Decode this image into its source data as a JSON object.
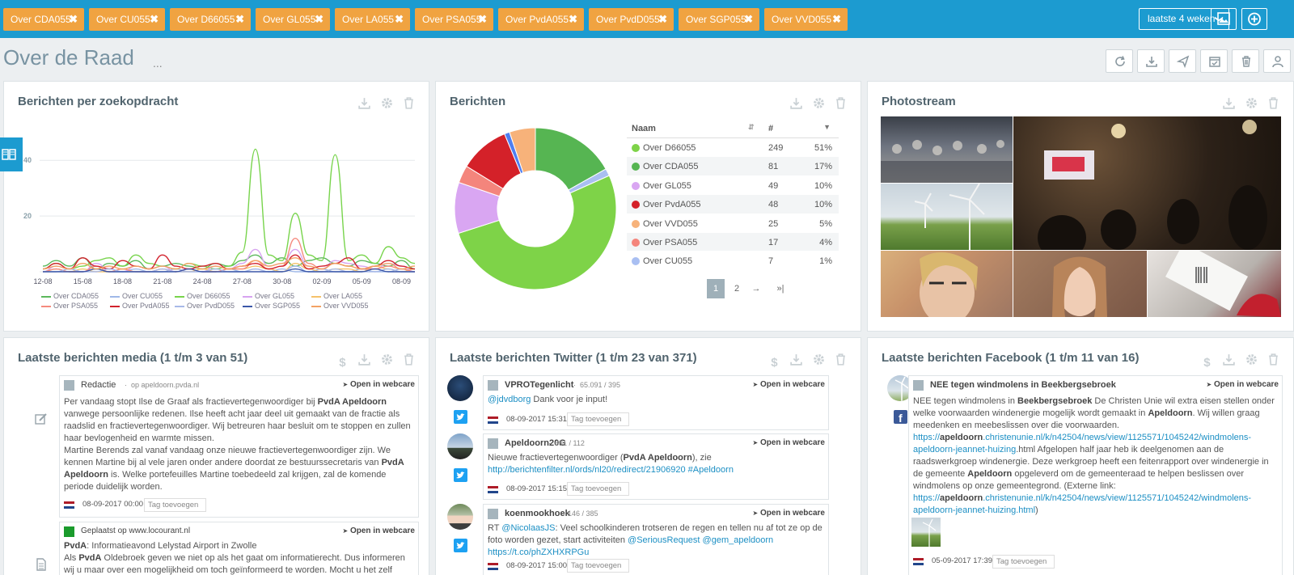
{
  "filters": [
    "Over CDA055",
    "Over CU055",
    "Over D66055",
    "Over GL055",
    "Over LA055",
    "Over PSA055",
    "Over PvdA055",
    "Over PvdD055",
    "Over SGP055",
    "Over VVD055"
  ],
  "filter_close_glyph": "✖",
  "period": {
    "label": "laatste 4 weken",
    "caret": "❯"
  },
  "page": {
    "title": "Over de Raad",
    "more": "..."
  },
  "colors": {
    "topbar": "#1c9bd0",
    "tag": "#f0a341",
    "link": "#1c8fc4"
  },
  "panels": {
    "line_title": "Berichten per zoekopdracht",
    "pie_title": "Berichten",
    "photo_title": "Photostream",
    "media_title": "Laatste berichten media (1 t/m 3 van 51)",
    "twitter_title": "Laatste berichten Twitter (1 t/m 23 van 371)",
    "facebook_title": "Laatste berichten Facebook (1 t/m 11 van 16)"
  },
  "chart_data": [
    {
      "type": "line",
      "title": "Berichten per zoekopdracht",
      "x": [
        "12-08",
        "13-08",
        "14-08",
        "15-08",
        "16-08",
        "17-08",
        "18-08",
        "19-08",
        "20-08",
        "21-08",
        "22-08",
        "23-08",
        "24-08",
        "25-08",
        "26-08",
        "27-08",
        "28-08",
        "29-08",
        "30-08",
        "31-08",
        "01-09",
        "02-09",
        "03-09",
        "04-09",
        "05-09",
        "06-09",
        "07-09",
        "08-09",
        "09-09"
      ],
      "xticks": [
        "12-08",
        "15-08",
        "18-08",
        "21-08",
        "24-08",
        "27-08",
        "30-08",
        "02-09",
        "05-09",
        "08-09"
      ],
      "yticks": [
        20,
        40
      ],
      "ylim": [
        0,
        45
      ],
      "series": [
        {
          "name": "Over CDA055",
          "color": "#5cb85c",
          "values": [
            2,
            4,
            2,
            5,
            1,
            3,
            2,
            4,
            1,
            2,
            3,
            2,
            1,
            3,
            2,
            4,
            6,
            3,
            5,
            2,
            4,
            5,
            3,
            2,
            4,
            3,
            2,
            4,
            1
          ]
        },
        {
          "name": "Over CU055",
          "color": "#9fb8e8",
          "values": [
            0,
            1,
            0,
            0,
            1,
            0,
            0,
            1,
            0,
            0,
            1,
            0,
            0,
            0,
            1,
            0,
            1,
            0,
            1,
            0,
            0,
            1,
            0,
            0,
            1,
            0,
            0,
            1,
            0
          ]
        },
        {
          "name": "Over D66055",
          "color": "#78d44c",
          "values": [
            1,
            3,
            1,
            2,
            4,
            5,
            2,
            6,
            3,
            2,
            1,
            3,
            2,
            1,
            2,
            7,
            44,
            6,
            4,
            21,
            6,
            4,
            42,
            4,
            6,
            3,
            9,
            5,
            3
          ]
        },
        {
          "name": "Over GL055",
          "color": "#d7a3f0",
          "values": [
            0,
            2,
            1,
            0,
            3,
            1,
            0,
            2,
            1,
            2,
            0,
            1,
            0,
            2,
            1,
            3,
            8,
            2,
            3,
            8,
            2,
            1,
            4,
            3,
            2,
            1,
            3,
            2,
            0
          ]
        },
        {
          "name": "Over LA055",
          "color": "#f5c26b",
          "values": [
            0,
            1,
            0,
            1,
            0,
            0,
            1,
            0,
            0,
            1,
            0,
            0,
            1,
            0,
            1,
            1,
            2,
            1,
            0,
            3,
            1,
            0,
            1,
            1,
            0,
            2,
            1,
            0,
            1
          ]
        },
        {
          "name": "Over PSA055",
          "color": "#f58a7e",
          "values": [
            0,
            1,
            0,
            0,
            2,
            0,
            1,
            0,
            0,
            1,
            0,
            1,
            0,
            0,
            1,
            1,
            4,
            1,
            2,
            12,
            3,
            1,
            3,
            2,
            1,
            1,
            2,
            1,
            0
          ]
        },
        {
          "name": "Over PvdA055",
          "color": "#d2222d",
          "values": [
            1,
            3,
            1,
            5,
            2,
            1,
            4,
            2,
            1,
            6,
            2,
            1,
            2,
            3,
            1,
            2,
            3,
            1,
            2,
            6,
            1,
            2,
            3,
            5,
            1,
            2,
            4,
            2,
            1
          ]
        },
        {
          "name": "Over PvdD055",
          "color": "#a8b9e8",
          "values": [
            0,
            0,
            1,
            0,
            0,
            1,
            0,
            0,
            0,
            1,
            0,
            0,
            0,
            1,
            0,
            0,
            1,
            0,
            0,
            2,
            0,
            0,
            1,
            0,
            0,
            0,
            1,
            0,
            0
          ]
        },
        {
          "name": "Over SGP055",
          "color": "#3b57a8",
          "values": [
            0,
            0,
            0,
            0,
            1,
            0,
            0,
            0,
            0,
            0,
            0,
            1,
            0,
            0,
            0,
            0,
            0,
            0,
            0,
            1,
            0,
            0,
            0,
            0,
            0,
            1,
            0,
            0,
            0
          ]
        },
        {
          "name": "Over VVD055",
          "color": "#f3a264",
          "values": [
            1,
            2,
            1,
            3,
            1,
            2,
            1,
            2,
            1,
            2,
            1,
            3,
            1,
            2,
            1,
            2,
            4,
            2,
            3,
            5,
            2,
            1,
            3,
            2,
            1,
            2,
            3,
            1,
            2
          ]
        }
      ]
    },
    {
      "type": "pie",
      "title": "Berichten",
      "columns": [
        "Naam",
        "#",
        ""
      ],
      "slices": [
        {
          "name": "Over D66055",
          "count": 249,
          "pct": "51%",
          "color": "#7ed348"
        },
        {
          "name": "Over CDA055",
          "count": 81,
          "pct": "17%",
          "color": "#56b552"
        },
        {
          "name": "Over GL055",
          "count": 49,
          "pct": "10%",
          "color": "#d9a6f2"
        },
        {
          "name": "Over PvdA055",
          "count": 48,
          "pct": "10%",
          "color": "#d42129"
        },
        {
          "name": "Over VVD055",
          "count": 25,
          "pct": "5%",
          "color": "#f7b27a"
        },
        {
          "name": "Over PSA055",
          "count": 17,
          "pct": "4%",
          "color": "#f4857c"
        },
        {
          "name": "Over CU055",
          "count": 7,
          "pct": "1%",
          "color": "#a9bff2"
        }
      ],
      "pie_order": [
        "Over CDA055",
        "Over CU055",
        "Over D66055",
        "Over GL055",
        "Over PSA055",
        "Over PvdA055",
        "Over PvdD055",
        "Over VVD055"
      ],
      "pie_extra": [
        {
          "name": "Over PvdD055",
          "count": 5,
          "color": "#4f7ef0"
        }
      ]
    }
  ],
  "pager": [
    "1",
    "2",
    "→",
    "»|"
  ],
  "media": [
    {
      "source": "Redactie",
      "meta": "op apeldoorn.pvda.nl",
      "open": "Open in webcare",
      "html": "Per vandaag stopt Ilse de Graaf als fractievertegenwoordiger bij <b>PvdA Apeldoorn</b> vanwege persoonlijke redenen. Ilse heeft acht jaar deel uit gemaakt van de fractie als raadslid en fractievertegenwoordiger. Wij betreuren haar besluit om te stoppen en zullen haar bevlogenheid en warmte missen.<br>Martine Berends zal vanaf vandaag onze nieuwe fractievertegenwoordiger zijn. We kennen Martine bij al vele jaren onder andere doordat ze bestuurssecretaris van <b>PvdA Apeldoorn</b> is. Welke portefeuilles Martine toebedeeld zal krijgen, zal de komende periode duidelijk worden.",
      "date": "08-09-2017 00:00",
      "tag_placeholder": "Tag toevoegen"
    },
    {
      "source": "Geplaatst op www.locourant.nl",
      "meta": "",
      "open": "Open in webcare",
      "html": "<b>PvdA</b>: Informatieavond Lelystad Airport in Zwolle<br>Als <b>PvdA</b> Oldebroek geven we niet op als het gaat om informatierecht. Dus informeren wij u maar over een mogelijkheid om toch geïnformeerd te worden. Mocht u het zelf",
      "date": "",
      "tag_placeholder": ""
    }
  ],
  "twitter": [
    {
      "user": "VPROTegenlicht",
      "meta": "65.091 / 395",
      "open": "Open in webcare",
      "html": "<span class='link'>@jdvdborg</span> Dank voor je input!",
      "date": "08-09-2017 15:31",
      "tag_placeholder": "Tag toevoegen"
    },
    {
      "user": "Apeldoorn20G",
      "meta": "631 / 112",
      "open": "Open in webcare",
      "html": "Nieuwe fractievertegenwoordiger (<b>PvdA Apeldoorn</b>), zie <span class='link'>http://berichtenfilter.nl/ords/nl20/redirect/21906920</span> <span class='link'>#Apeldoorn</span>",
      "date": "08-09-2017 15:15",
      "tag_placeholder": "Tag toevoegen"
    },
    {
      "user": "koenmookhoek",
      "meta": "146 / 385",
      "open": "Open in webcare",
      "html": "RT <span class='link'>@NicolaasJS</span>: Veel schoolkinderen trotseren de regen en tellen nu af tot ze op de foto worden gezet, start activiteiten <span class='link'>@SeriousRequest</span> <span class='link'>@gem_apeldoorn</span> <span class='link'>https://t.co/phZXHXRPGu</span>",
      "date": "08-09-2017 15:00",
      "tag_placeholder": "Tag toevoegen"
    }
  ],
  "facebook": [
    {
      "page": "NEE tegen windmolens in Beekbergsebroek",
      "open": "Open in webcare",
      "html": "NEE tegen windmolens in <b>Beekbergsebroek</b> De Christen Unie wil extra eisen stellen onder welke voorwaarden windenergie mogelijk wordt gemaakt in <b>Apeldoorn</b>. Wij willen graag meedenken en meebeslissen over die voorwaarden. <span class='link'>https://<b>apeldoorn</b>.christenunie.nl/k/n42504/news/view/1125571/1045242/windmolens-apeldoorn-jeannet-huizing</span>.html Afgelopen half jaar heb ik deelgenomen aan de raadswerkgroep windenergie. Deze werkgroep heeft een feitenrapport over windenergie in de gemeente <b>Apeldoorn</b> opgeleverd om de gemeenteraad te helpen beslissen over windmolens op onze gemeentegrond. (Externe link: <span class='link'>https://<b>apeldoorn</b>.christenunie.nl/k/n42504/news/view/1125571/1045242/windmolens-apeldoorn-jeannet-huizing.html</span>)",
      "date": "05-09-2017 17:39",
      "tag_placeholder": "Tag toevoegen"
    }
  ]
}
